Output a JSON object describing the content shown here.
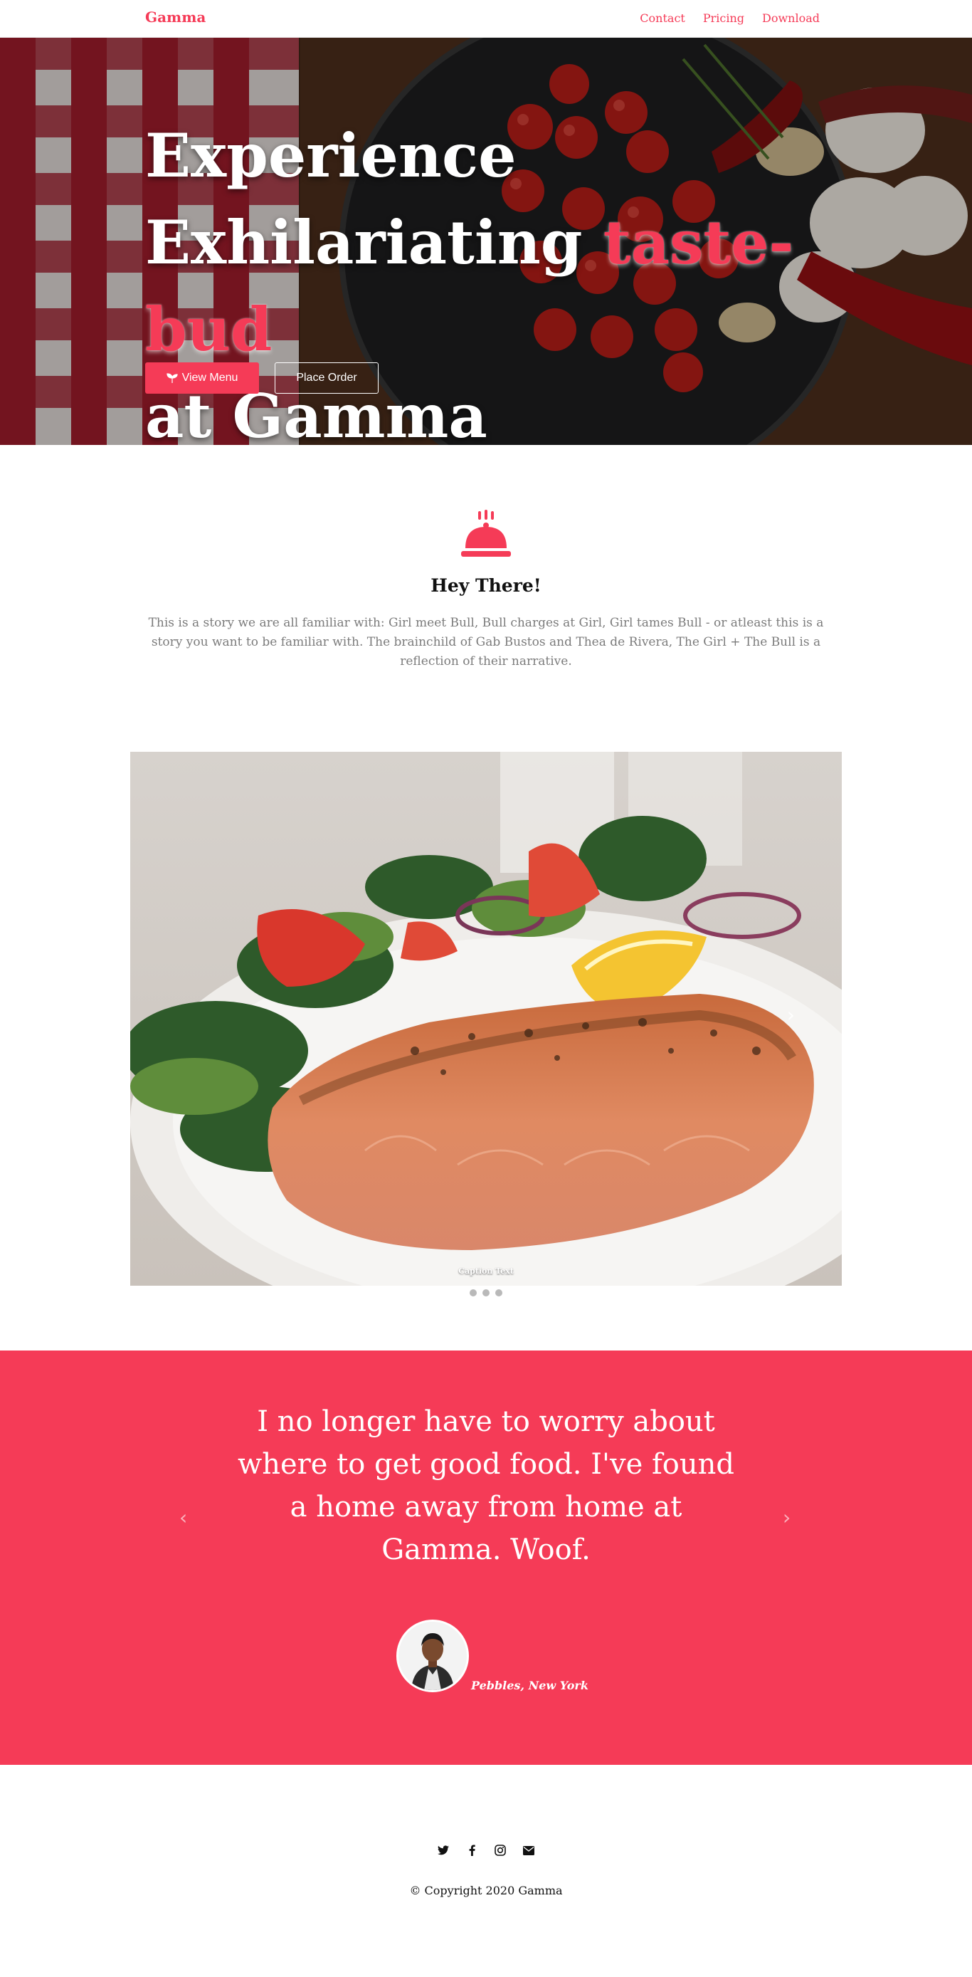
{
  "nav": {
    "brand": "Gamma",
    "links": [
      "Contact",
      "Pricing",
      "Download"
    ]
  },
  "hero": {
    "line1": "Experience",
    "line2": "Exhilariating",
    "highlight": "taste-bud",
    "line3": "at Gamma",
    "primary_button": "View Menu",
    "primary_button_icon": "seedling-icon",
    "secondary_button": "Place Order"
  },
  "intro": {
    "icon": "service-bell-icon",
    "title": "Hey There!",
    "text": "This is a story we are all familiar with: Girl meet Bull, Bull charges at Girl, Girl tames Bull - or atleast this is a story you want to be familiar with. The brainchild of Gab Bustos and Thea de Rivera, The Girl + The Bull is a reflection of their narrative."
  },
  "carousel": {
    "caption": "Caption Text",
    "next_glyph": "›",
    "slide_count": 3
  },
  "testimonial": {
    "quote": "I no longer have to worry about where to get good food. I've found a home away from home at Gamma. Woof.",
    "author": "Pebbles, New York",
    "prev_glyph": "‹",
    "next_glyph": "›"
  },
  "footer": {
    "socials": [
      "twitter-icon",
      "facebook-icon",
      "instagram-icon",
      "envelope-icon"
    ],
    "copyright": "© Copyright 2020 Gamma"
  },
  "colors": {
    "accent": "#f53b57",
    "text_muted": "#7b7b7b"
  }
}
